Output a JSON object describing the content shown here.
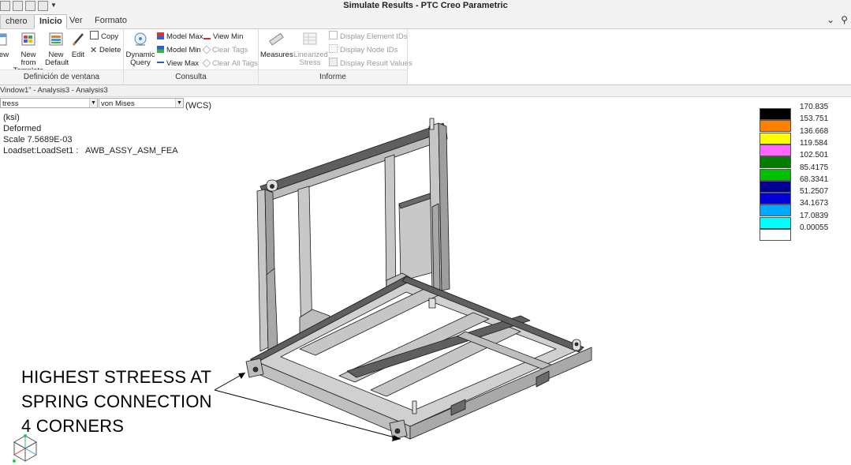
{
  "window": {
    "title": "Simulate Results - PTC Creo Parametric"
  },
  "tabs": [
    {
      "label": "chero",
      "id": "file"
    },
    {
      "label": "Inicio",
      "id": "home",
      "active": true
    },
    {
      "label": "Ver",
      "id": "view"
    },
    {
      "label": "Formato",
      "id": "format"
    }
  ],
  "ribbon": {
    "window_group": {
      "label": "Definición de ventana",
      "buttons": {
        "new_partial": "ew",
        "new_template_1": "New from",
        "new_template_2": "Template",
        "new_default_1": "New",
        "new_default_2": "Default",
        "edit": "Edit",
        "copy": "Copy",
        "delete": "Delete"
      }
    },
    "query_group": {
      "label": "Consulta",
      "buttons": {
        "dynamic_query_1": "Dynamic",
        "dynamic_query_2": "Query",
        "model_max": "Model Max",
        "model_min": "Model Min",
        "view_max": "View Max",
        "view_min": "View Min",
        "clear_tags": "Clear Tags",
        "clear_all_tags": "Clear All Tags"
      }
    },
    "report_group": {
      "label": "Informe",
      "buttons": {
        "measures": "Measures",
        "linearized_1": "Linearized",
        "linearized_2": "Stress",
        "display_element_ids": "Display Element IDs",
        "display_node_ids": "Display Node IDs",
        "display_result_values": "Display Result Values"
      }
    }
  },
  "pathbar": {
    "text": "Vindow1\" - Analysis3 - Analysis3"
  },
  "selectors": {
    "quantity": "tress",
    "component": "von Mises",
    "csys": "(WCS)"
  },
  "result_info": {
    "units": "(ksi)",
    "mode": "Deformed",
    "scale": "Scale  7.5689E-03",
    "loadset": "Loadset:LoadSet1 :   AWB_ASSY_ASM_FEA"
  },
  "legend": {
    "levels": [
      {
        "value": "170.835",
        "color": "#000000"
      },
      {
        "value": "153.751",
        "color": "#ff7f00"
      },
      {
        "value": "136.668",
        "color": "#ffff00"
      },
      {
        "value": "119.584",
        "color": "#ff66ff"
      },
      {
        "value": "102.501",
        "color": "#007d00"
      },
      {
        "value": "85.4175",
        "color": "#00c000"
      },
      {
        "value": "68.3341",
        "color": "#000090"
      },
      {
        "value": "51.2507",
        "color": "#0000d8"
      },
      {
        "value": "34.1673",
        "color": "#00a8ff"
      },
      {
        "value": "17.0839",
        "color": "#00ffff"
      },
      {
        "value": "0.00055",
        "color": "#ffffff"
      }
    ]
  },
  "annotation": {
    "line1": "HIGHEST STREESS AT",
    "line2": "SPRING CONNECTION",
    "line3": "4 CORNERS"
  },
  "colors": {
    "model_fill": "#c6c6c6",
    "model_dark": "#5f5f5f",
    "model_edge": "#1a1a1a"
  }
}
